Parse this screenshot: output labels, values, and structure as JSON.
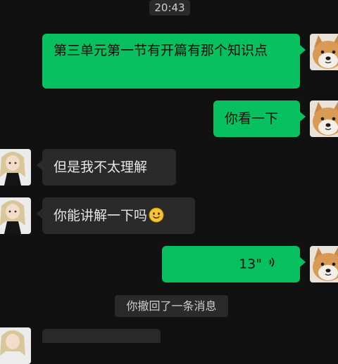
{
  "chat": {
    "timestamp": "20:43",
    "messages": [
      {
        "side": "out",
        "text": "第三单元第一节有开篇有那个知识点"
      },
      {
        "side": "out",
        "text": "你看一下"
      },
      {
        "side": "in",
        "text": "但是我不太理解"
      },
      {
        "side": "in",
        "text": "你能讲解一下吗",
        "emoji": "smiling-face-emoji"
      },
      {
        "side": "out",
        "type": "voice",
        "duration": "13\""
      }
    ],
    "recall_notice": "你撤回了一条消息"
  },
  "colors": {
    "background": "#111111",
    "outgoing_bubble": "#07c160",
    "incoming_bubble": "#2a2a2a"
  }
}
